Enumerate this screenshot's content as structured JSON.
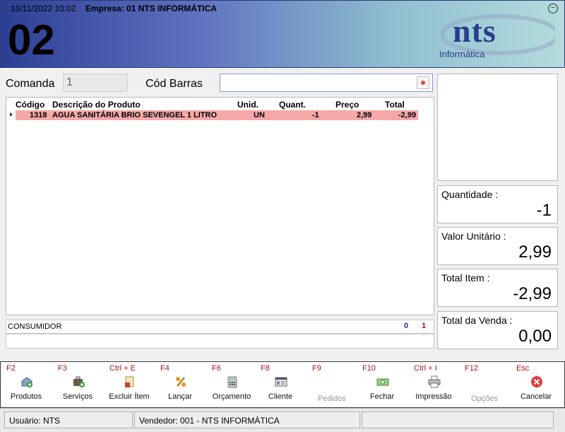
{
  "header": {
    "date": "16/11/2022 10:02",
    "company": "Empresa: 01 NTS INFORMÁTICA",
    "number": "02",
    "logo_text": "nts",
    "logo_sub": "Informática",
    "minimize_symbol": "−"
  },
  "form": {
    "comanda_label": "Comanda",
    "comanda_value": "1",
    "barcode_label": "Cód Barras",
    "barcode_value": ""
  },
  "grid": {
    "columns": [
      "Código",
      "Descrição do Produto",
      "Unid.",
      "Quant.",
      "Preço",
      "Total"
    ],
    "rows": [
      {
        "codigo": "1318",
        "descricao": "AGUA SANITÁRIA BRIO SEVENGEL 1 LITRO",
        "unid": "UN",
        "quant": "-1",
        "preco": "2,99",
        "total": "-2,99"
      }
    ]
  },
  "customer": {
    "name": "CONSUMIDOR",
    "count_a": "0",
    "count_b": "1"
  },
  "panels": {
    "quantidade_label": "Quantidade :",
    "quantidade_value": "-1",
    "valor_unitario_label": "Valor Unitário :",
    "valor_unitario_value": "2,99",
    "total_item_label": "Total Item :",
    "total_item_value": "-2,99",
    "total_venda_label": "Total da Venda :",
    "total_venda_value": "0,00"
  },
  "toolbar": [
    {
      "key": "F2",
      "label": "Produtos",
      "icon": "products-icon",
      "enabled": true
    },
    {
      "key": "F3",
      "label": "Serviços",
      "icon": "services-icon",
      "enabled": true
    },
    {
      "key": "Ctrl + E",
      "label": "Excluir Ítem",
      "icon": "delete-item-icon",
      "enabled": true
    },
    {
      "key": "F4",
      "label": "Lançar",
      "icon": "percent-icon",
      "enabled": true
    },
    {
      "key": "F6",
      "label": "Orçamento",
      "icon": "calculator-icon",
      "enabled": true
    },
    {
      "key": "F8",
      "label": "Cliente",
      "icon": "client-card-icon",
      "enabled": true
    },
    {
      "key": "F9",
      "label": "Pedidos",
      "icon": "orders-icon",
      "enabled": false
    },
    {
      "key": "F10",
      "label": "Fechar",
      "icon": "money-icon",
      "enabled": true
    },
    {
      "key": "Ctrl + I",
      "label": "Impressão",
      "icon": "printer-icon",
      "enabled": true
    },
    {
      "key": "F12",
      "label": "Opções",
      "icon": "options-icon",
      "enabled": false
    },
    {
      "key": "Esc",
      "label": "Cancelar",
      "icon": "cancel-icon",
      "enabled": true
    }
  ],
  "statusbar": {
    "usuario": "Usuário: NTS",
    "vendedor": "Vendedor: 001 - NTS INFORMÁTICA",
    "extra": ""
  },
  "colors": {
    "header_start": "#2d3f95",
    "header_end": "#b4dcdc",
    "row_highlight": "#f5a8a8",
    "shortcut_key": "#b01010",
    "logo": "#2a3d8c"
  }
}
